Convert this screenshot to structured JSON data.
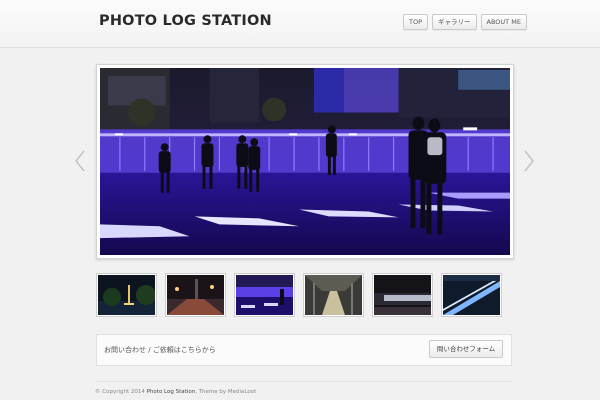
{
  "header": {
    "site_title": "PHOTO LOG STATION",
    "nav": [
      {
        "label": "TOP"
      },
      {
        "label": "ギャラリー"
      },
      {
        "label": "ABOUT ME"
      }
    ]
  },
  "slider": {
    "prev_icon": "chevron-left-icon",
    "next_icon": "chevron-right-icon",
    "colors": {
      "accent_violet": "#6a45ff",
      "night_blue": "#160a55"
    }
  },
  "thumbnails": [
    {
      "name": "night-tower"
    },
    {
      "name": "street-lights"
    },
    {
      "name": "plaza"
    },
    {
      "name": "station"
    },
    {
      "name": "train"
    },
    {
      "name": "light-trails"
    }
  ],
  "contact": {
    "text": "お問い合わせ / ご依頼はこちらから",
    "button_label": "問い合わせフォーム"
  },
  "footer": {
    "prefix": "© Copyright 2014",
    "site_name": "Photo Log Station",
    "theme_text": ", Theme by MediaLoot"
  }
}
